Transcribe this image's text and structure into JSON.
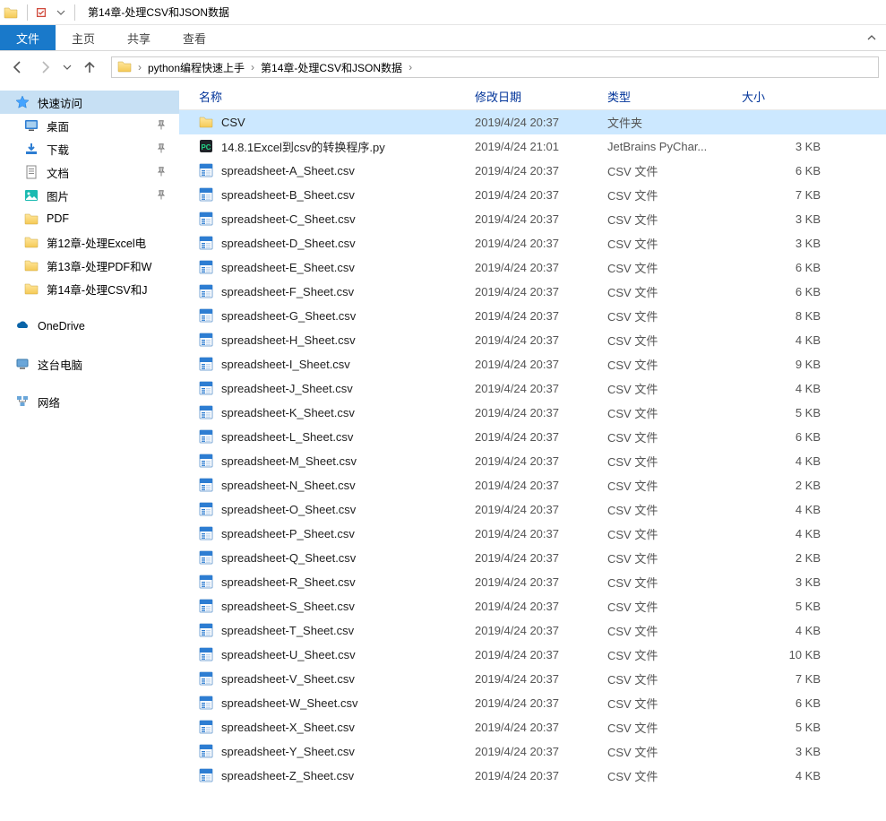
{
  "window": {
    "title": "第14章-处理CSV和JSON数据"
  },
  "ribbon": {
    "file": "文件",
    "tabs": [
      "主页",
      "共享",
      "查看"
    ]
  },
  "breadcrumb": {
    "items": [
      "python编程快速上手",
      "第14章-处理CSV和JSON数据"
    ]
  },
  "nav": {
    "quick_access": "快速访问",
    "pinned": [
      {
        "label": "桌面",
        "icon": "desktop"
      },
      {
        "label": "下载",
        "icon": "downloads"
      },
      {
        "label": "文档",
        "icon": "documents"
      },
      {
        "label": "图片",
        "icon": "pictures"
      }
    ],
    "recent": [
      {
        "label": "PDF"
      },
      {
        "label": "第12章-处理Excel电"
      },
      {
        "label": "第13章-处理PDF和W"
      },
      {
        "label": "第14章-处理CSV和J"
      }
    ],
    "onedrive": "OneDrive",
    "this_pc": "这台电脑",
    "network": "网络"
  },
  "columns": {
    "name": "名称",
    "date": "修改日期",
    "type": "类型",
    "size": "大小"
  },
  "files": [
    {
      "name": "CSV",
      "date": "2019/4/24 20:37",
      "type": "文件夹",
      "size": "",
      "icon": "folder",
      "selected": true
    },
    {
      "name": "14.8.1Excel到csv的转换程序.py",
      "date": "2019/4/24 21:01",
      "type": "JetBrains PyChar...",
      "size": "3 KB",
      "icon": "py"
    },
    {
      "name": "spreadsheet-A_Sheet.csv",
      "date": "2019/4/24 20:37",
      "type": "CSV 文件",
      "size": "6 KB",
      "icon": "csv"
    },
    {
      "name": "spreadsheet-B_Sheet.csv",
      "date": "2019/4/24 20:37",
      "type": "CSV 文件",
      "size": "7 KB",
      "icon": "csv"
    },
    {
      "name": "spreadsheet-C_Sheet.csv",
      "date": "2019/4/24 20:37",
      "type": "CSV 文件",
      "size": "3 KB",
      "icon": "csv"
    },
    {
      "name": "spreadsheet-D_Sheet.csv",
      "date": "2019/4/24 20:37",
      "type": "CSV 文件",
      "size": "3 KB",
      "icon": "csv"
    },
    {
      "name": "spreadsheet-E_Sheet.csv",
      "date": "2019/4/24 20:37",
      "type": "CSV 文件",
      "size": "6 KB",
      "icon": "csv"
    },
    {
      "name": "spreadsheet-F_Sheet.csv",
      "date": "2019/4/24 20:37",
      "type": "CSV 文件",
      "size": "6 KB",
      "icon": "csv"
    },
    {
      "name": "spreadsheet-G_Sheet.csv",
      "date": "2019/4/24 20:37",
      "type": "CSV 文件",
      "size": "8 KB",
      "icon": "csv"
    },
    {
      "name": "spreadsheet-H_Sheet.csv",
      "date": "2019/4/24 20:37",
      "type": "CSV 文件",
      "size": "4 KB",
      "icon": "csv"
    },
    {
      "name": "spreadsheet-I_Sheet.csv",
      "date": "2019/4/24 20:37",
      "type": "CSV 文件",
      "size": "9 KB",
      "icon": "csv"
    },
    {
      "name": "spreadsheet-J_Sheet.csv",
      "date": "2019/4/24 20:37",
      "type": "CSV 文件",
      "size": "4 KB",
      "icon": "csv"
    },
    {
      "name": "spreadsheet-K_Sheet.csv",
      "date": "2019/4/24 20:37",
      "type": "CSV 文件",
      "size": "5 KB",
      "icon": "csv"
    },
    {
      "name": "spreadsheet-L_Sheet.csv",
      "date": "2019/4/24 20:37",
      "type": "CSV 文件",
      "size": "6 KB",
      "icon": "csv"
    },
    {
      "name": "spreadsheet-M_Sheet.csv",
      "date": "2019/4/24 20:37",
      "type": "CSV 文件",
      "size": "4 KB",
      "icon": "csv"
    },
    {
      "name": "spreadsheet-N_Sheet.csv",
      "date": "2019/4/24 20:37",
      "type": "CSV 文件",
      "size": "2 KB",
      "icon": "csv"
    },
    {
      "name": "spreadsheet-O_Sheet.csv",
      "date": "2019/4/24 20:37",
      "type": "CSV 文件",
      "size": "4 KB",
      "icon": "csv"
    },
    {
      "name": "spreadsheet-P_Sheet.csv",
      "date": "2019/4/24 20:37",
      "type": "CSV 文件",
      "size": "4 KB",
      "icon": "csv"
    },
    {
      "name": "spreadsheet-Q_Sheet.csv",
      "date": "2019/4/24 20:37",
      "type": "CSV 文件",
      "size": "2 KB",
      "icon": "csv"
    },
    {
      "name": "spreadsheet-R_Sheet.csv",
      "date": "2019/4/24 20:37",
      "type": "CSV 文件",
      "size": "3 KB",
      "icon": "csv"
    },
    {
      "name": "spreadsheet-S_Sheet.csv",
      "date": "2019/4/24 20:37",
      "type": "CSV 文件",
      "size": "5 KB",
      "icon": "csv"
    },
    {
      "name": "spreadsheet-T_Sheet.csv",
      "date": "2019/4/24 20:37",
      "type": "CSV 文件",
      "size": "4 KB",
      "icon": "csv"
    },
    {
      "name": "spreadsheet-U_Sheet.csv",
      "date": "2019/4/24 20:37",
      "type": "CSV 文件",
      "size": "10 KB",
      "icon": "csv"
    },
    {
      "name": "spreadsheet-V_Sheet.csv",
      "date": "2019/4/24 20:37",
      "type": "CSV 文件",
      "size": "7 KB",
      "icon": "csv"
    },
    {
      "name": "spreadsheet-W_Sheet.csv",
      "date": "2019/4/24 20:37",
      "type": "CSV 文件",
      "size": "6 KB",
      "icon": "csv"
    },
    {
      "name": "spreadsheet-X_Sheet.csv",
      "date": "2019/4/24 20:37",
      "type": "CSV 文件",
      "size": "5 KB",
      "icon": "csv"
    },
    {
      "name": "spreadsheet-Y_Sheet.csv",
      "date": "2019/4/24 20:37",
      "type": "CSV 文件",
      "size": "3 KB",
      "icon": "csv"
    },
    {
      "name": "spreadsheet-Z_Sheet.csv",
      "date": "2019/4/24 20:37",
      "type": "CSV 文件",
      "size": "4 KB",
      "icon": "csv"
    }
  ]
}
